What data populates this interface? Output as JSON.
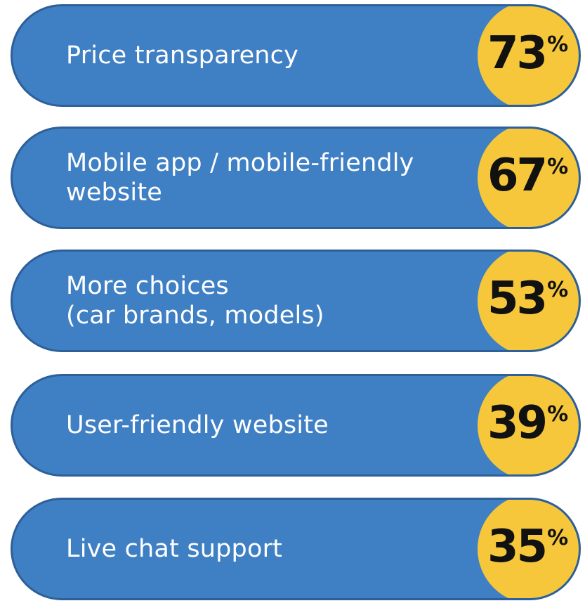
{
  "chart_data": {
    "type": "bar",
    "categories": [
      [
        "Price transparency"
      ],
      [
        "Mobile app / mobile-friendly",
        "website"
      ],
      [
        "More choices",
        "(car brands, models)"
      ],
      [
        "User-friendly website"
      ],
      [
        "Live chat support"
      ]
    ],
    "values": [
      73,
      67,
      53,
      39,
      35
    ],
    "value_text": [
      "73",
      "67",
      "53",
      "39",
      "35"
    ],
    "unit": "%",
    "title": "",
    "colors": {
      "pill": "#3f7fc4",
      "pill_border": "#2d5f99",
      "badge": "#f6c73a",
      "label_text": "#ffffff",
      "value_text": "#111111"
    }
  }
}
